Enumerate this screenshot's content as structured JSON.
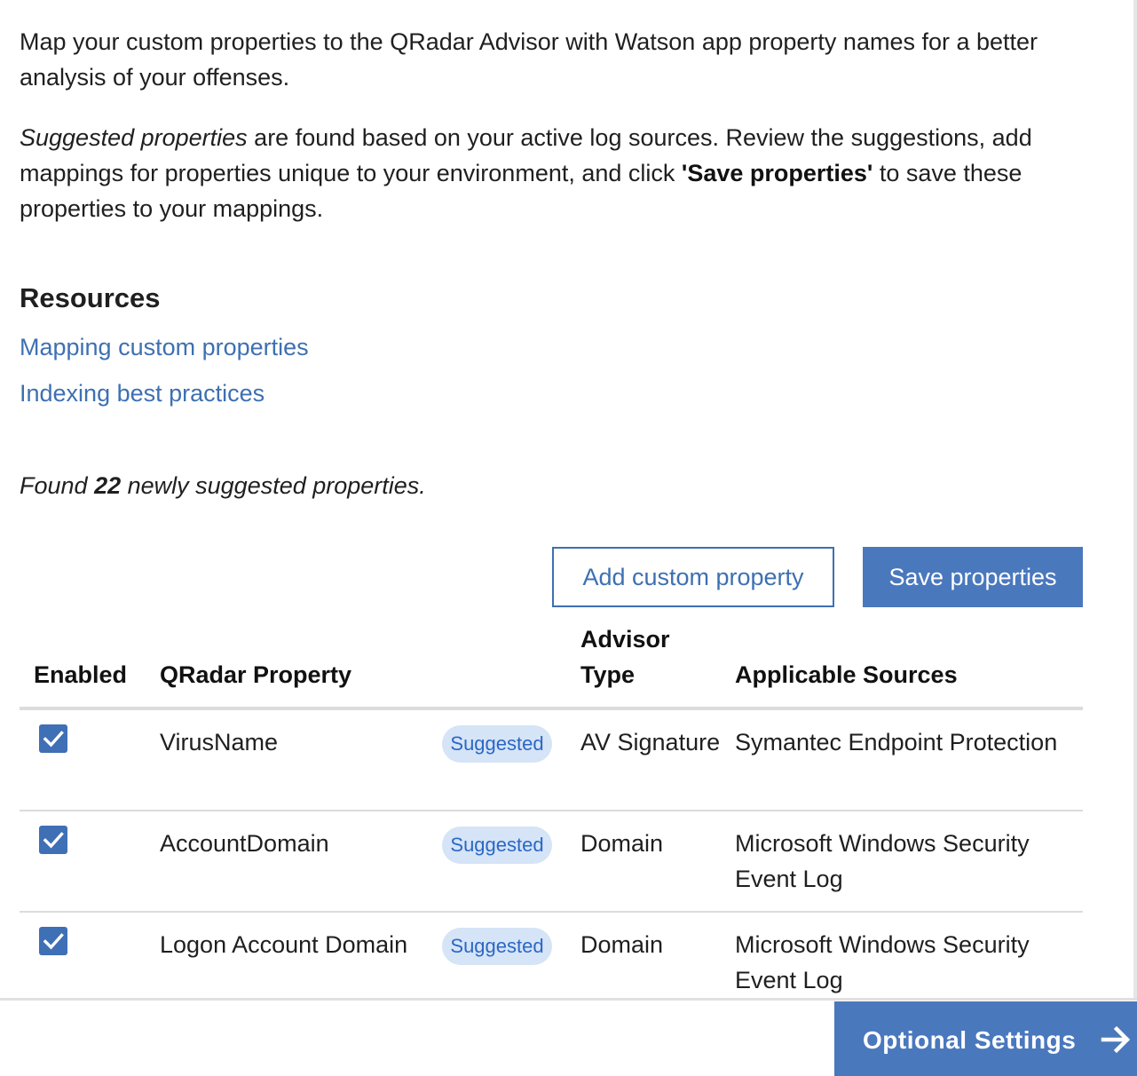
{
  "intro": {
    "line1": "Map your custom properties to the QRadar Advisor with Watson app property names for a better analysis of your offenses.",
    "suggested_em": "Suggested properties",
    "line2_part1": " are found based on your active log sources. Review the suggestions, add mappings for properties unique to your environment, and click ",
    "save_ref": "'Save properties'",
    "line2_part2": " to save these properties to your mappings."
  },
  "resources": {
    "heading": "Resources",
    "links": [
      "Mapping custom properties",
      "Indexing best practices"
    ]
  },
  "found": {
    "prefix": "Found ",
    "count": "22",
    "suffix": " newly suggested properties."
  },
  "actions": {
    "add_label": "Add custom property",
    "save_label": "Save properties"
  },
  "table": {
    "headers": {
      "enabled": "Enabled",
      "qradar": "QRadar Property",
      "advisor": "Advisor Type",
      "sources": "Applicable Sources"
    },
    "rows": [
      {
        "checked": true,
        "property": "VirusName",
        "tag": "Suggested",
        "type": "AV Signature",
        "sources": "Symantec Endpoint Protection"
      },
      {
        "checked": true,
        "property": "AccountDomain",
        "tag": "Suggested",
        "type": "Domain",
        "sources": "Microsoft Windows Security Event Log"
      },
      {
        "checked": true,
        "property": "Logon Account Domain",
        "tag": "Suggested",
        "type": "Domain",
        "sources": "Microsoft Windows Security Event Log"
      }
    ]
  },
  "footer": {
    "next_label": "Optional Settings",
    "next_icon": "arrow-right-icon"
  },
  "colors": {
    "primary": "#4a78bd",
    "link": "#3d70b2",
    "tag_bg": "#d5e4f6",
    "tag_text": "#2b67c6"
  }
}
